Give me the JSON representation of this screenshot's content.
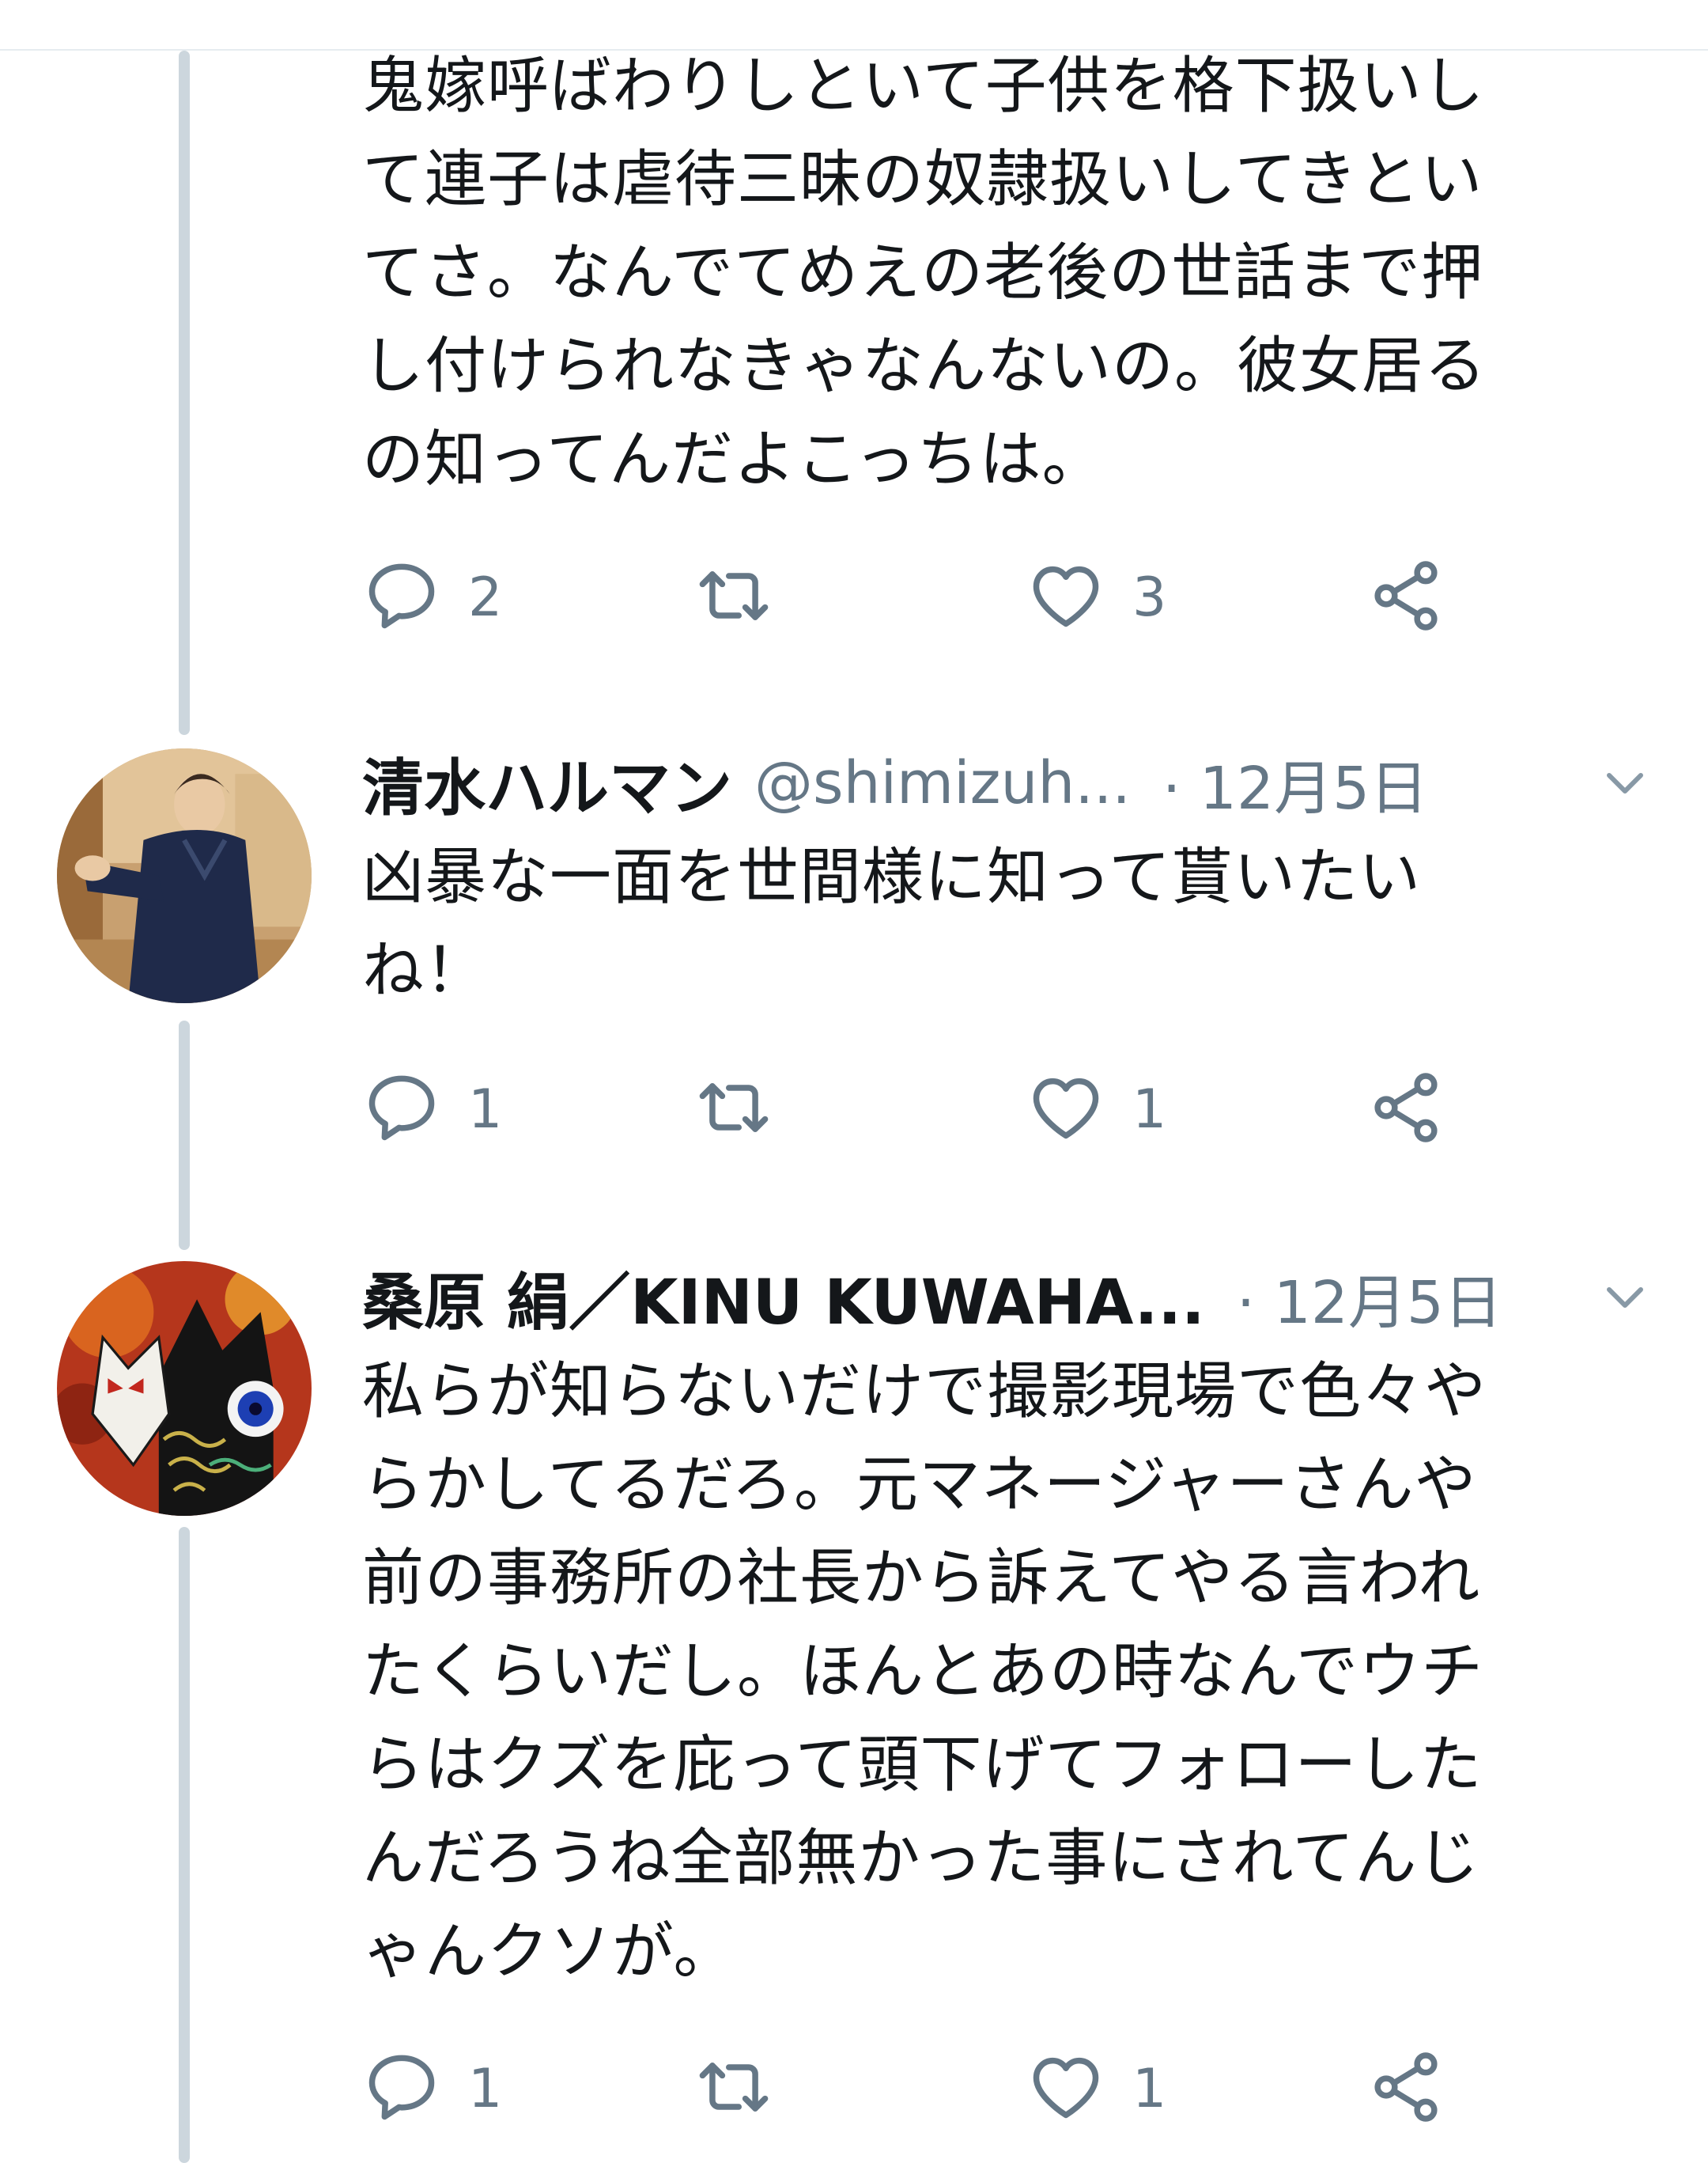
{
  "thread": [
    {
      "text": "鬼嫁呼ばわりしといて子供を格下扱いし\nて連子は虐待三昧の奴隷扱いしてきとい\nてさ。なんでてめえの老後の世話まで押\nし付けられなきゃなんないの。彼女居る\nの知ってんだよこっちは。",
      "replies": "2",
      "retweets": "",
      "likes": "3"
    },
    {
      "name": "清水ハルマン",
      "handle": "@shimizuh...",
      "date": "· 12月5日",
      "text": "凶暴な一面を世間様に知って貰いたい\nね！",
      "replies": "1",
      "retweets": "",
      "likes": "1",
      "avatar_icon": "photo-person-in-navy-kimono"
    },
    {
      "name": "桑原 絹／KINU KUWAHA...",
      "date": "· 12月5日",
      "text": "私らが知らないだけで撮影現場で色々や\nらかしてるだろ。元マネージャーさんや\n前の事務所の社長から訴えてやる言われ\nたくらいだし。ほんとあの時なんでウチ\nらはクズを庇って頭下げてフォローした\nんだろうね全部無かった事にされてんじ\nゃんクソが。",
      "replies": "1",
      "retweets": "",
      "likes": "1",
      "avatar_icon": "illustration-fox-masks"
    }
  ],
  "icons": {
    "reply": "reply-bubble-icon",
    "retweet": "retweet-icon",
    "like": "heart-icon",
    "share": "share-icon",
    "more": "chevron-down-icon"
  },
  "colors": {
    "text": "#14171a",
    "secondary": "#657786",
    "thread_line": "#ccd6dd"
  }
}
